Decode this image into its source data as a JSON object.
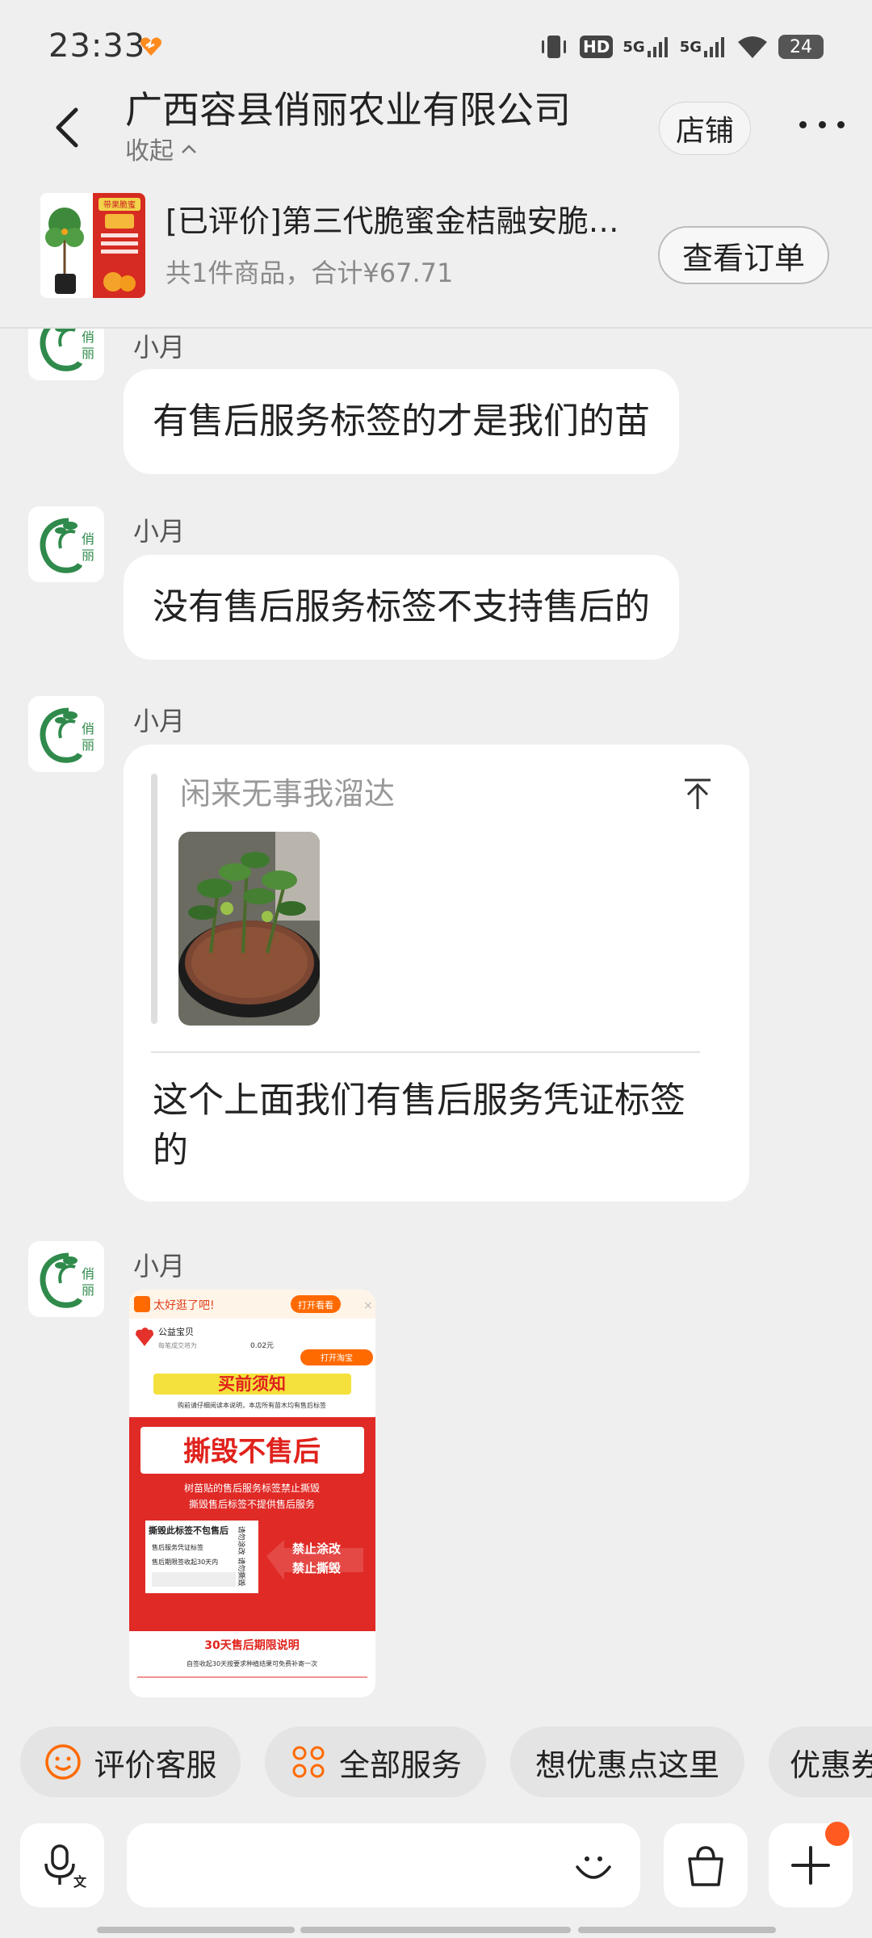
{
  "status_bar": {
    "time": "23:33",
    "hd_label": "HD",
    "network1": "5G",
    "network2": "5G",
    "battery": "24"
  },
  "header": {
    "title": "广西容县俏丽农业有限公司",
    "collapse_label": "收起",
    "store_button": "店铺",
    "more_icon": "more-icon"
  },
  "order": {
    "title": "[已评价]第三代脆蜜金桔融安脆…",
    "summary": "共1件商品，合计¥67.71",
    "view_button": "查看订单",
    "thumb_tag": "带果脆蜜"
  },
  "messages": [
    {
      "sender": "小月",
      "text": "有售后服务标签的才是我们的苗"
    },
    {
      "sender": "小月",
      "text": "没有售后服务标签不支持售后的"
    },
    {
      "sender": "小月",
      "quote_name": "闲来无事我溜达",
      "text": "这个上面我们有售后服务凭证标签的"
    },
    {
      "sender": "小月"
    }
  ],
  "poster": {
    "banner_text": "太好逛了吧!",
    "banner_btn": "打开看看",
    "charity_title": "公益宝贝",
    "charity_amount": "0.02元",
    "open_taobao": "打开淘宝",
    "notice_title": "买前须知",
    "notice_sub": "购前请仔细阅读本说明，本店所有苗木均有售后标签",
    "big_title": "撕毁不售后",
    "line1": "树苗贴的售后服务标签禁止撕毁",
    "line2": "撕毁售后标签不提供售后服务",
    "tag_title": "撕毁此标签不包售后",
    "tag_line1": "售后服务凭证标签",
    "tag_line2": "售后期限签收起30天内",
    "tag_side": "请勿涂改 请勿撕毁",
    "arrow1": "禁止涂改",
    "arrow2": "禁止撕毁",
    "footer_title": "30天售后期限说明",
    "footer_text": "自签收起30天按要求种植结果可免费补寄一次"
  },
  "chips": [
    {
      "label": "评价客服",
      "icon": "smile-icon"
    },
    {
      "label": "全部服务",
      "icon": "grid-icon"
    },
    {
      "label": "想优惠点这里"
    },
    {
      "label": "优惠券"
    }
  ],
  "input": {
    "placeholder": ""
  },
  "colors": {
    "accent_orange": "#ff6a00",
    "brand_green": "#2f8a4b",
    "poster_red": "#e02a26"
  }
}
